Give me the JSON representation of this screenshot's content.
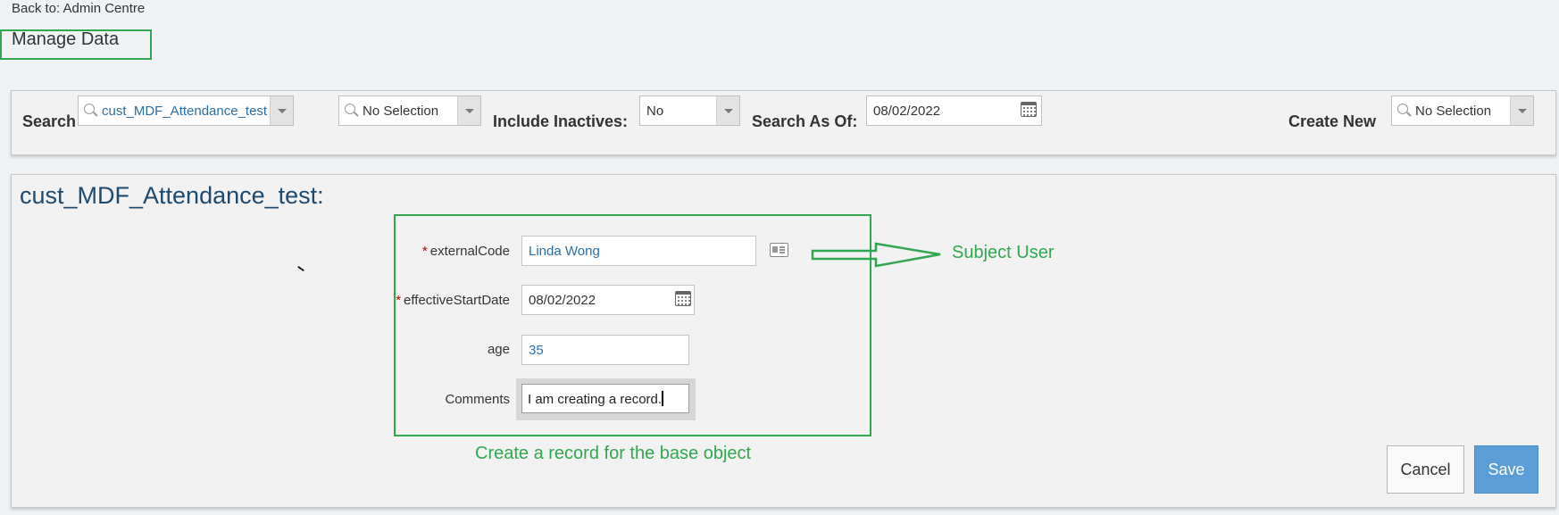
{
  "header": {
    "back_link": "Back to: Admin Centre",
    "page_title": "Manage Data"
  },
  "search_bar": {
    "search_label": "Search",
    "search_value": "cust_MDF_Attendance_test",
    "search_secondary_value": "No Selection",
    "include_inactives_label": "Include Inactives:",
    "include_inactives_value": "No",
    "search_as_of_label": "Search As Of:",
    "search_as_of_value": "08/02/2022",
    "create_new_label": "Create New",
    "create_new_value": "No Selection"
  },
  "object": {
    "title": "cust_MDF_Attendance_test:",
    "fields": {
      "external_code": {
        "label": "externalCode",
        "value": "Linda Wong",
        "required": "*"
      },
      "effective_start_date": {
        "label": "effectiveStartDate",
        "value": "08/02/2022",
        "required": "*"
      },
      "age": {
        "label": "age",
        "value": "35"
      },
      "comments": {
        "label": "Comments",
        "value": "I am creating a record."
      }
    }
  },
  "annotations": {
    "subject_user": "Subject User",
    "create_record": "Create a record for the base object",
    "color": "#2fa84f"
  },
  "buttons": {
    "cancel": "Cancel",
    "save": "Save"
  },
  "colors": {
    "accent_save": "#5b9ed6",
    "title_blue": "#1d4a6e",
    "link_blue": "#2a6ea6"
  }
}
